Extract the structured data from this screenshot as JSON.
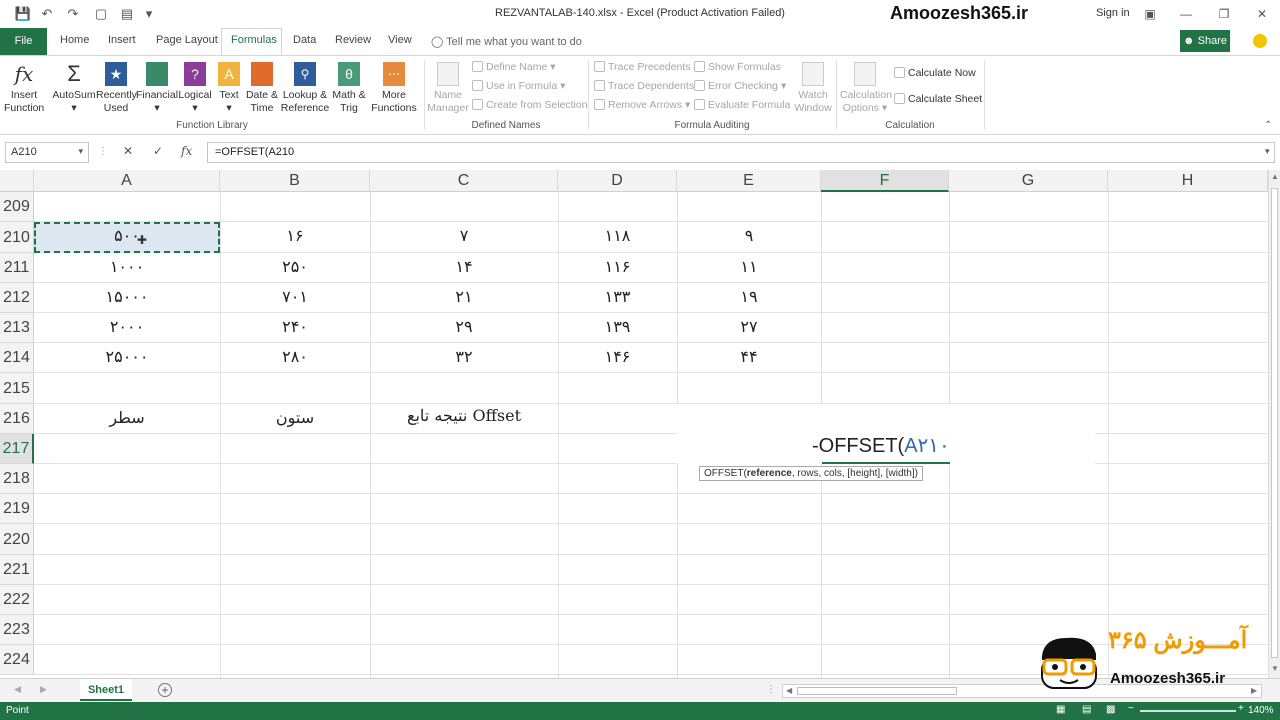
{
  "window": {
    "title": "REZVANTALAB-140.xlsx - Excel (Product Activation Failed)",
    "brand": "Amoozesh365.ir",
    "signin": "Sign in"
  },
  "tabs": [
    "File",
    "Home",
    "Insert",
    "Page Layout",
    "Formulas",
    "Data",
    "Review",
    "View"
  ],
  "active_tab": "Formulas",
  "tellme": "Tell me what you want to do",
  "share": "Share",
  "ribbon": {
    "insert_function": [
      "Insert",
      "Function"
    ],
    "autosum": "AutoSum",
    "recently_used": [
      "Recently",
      "Used"
    ],
    "financial": "Financial",
    "logical": "Logical",
    "text": "Text",
    "date_time": [
      "Date &",
      "Time"
    ],
    "lookup": [
      "Lookup &",
      "Reference"
    ],
    "math_trig": [
      "Math &",
      "Trig"
    ],
    "more_functions": [
      "More",
      "Functions"
    ],
    "function_library": "Function Library",
    "name_manager": [
      "Name",
      "Manager"
    ],
    "define_name": "Define Name",
    "use_in_formula": "Use in Formula",
    "create_from_selection": "Create from Selection",
    "defined_names": "Defined Names",
    "trace_precedents": "Trace Precedents",
    "trace_dependents": "Trace Dependents",
    "remove_arrows": "Remove Arrows",
    "show_formulas": "Show Formulas",
    "error_checking": "Error Checking",
    "evaluate_formula": "Evaluate Formula",
    "watch_window": [
      "Watch",
      "Window"
    ],
    "formula_auditing": "Formula Auditing",
    "calculation_options": [
      "Calculation",
      "Options"
    ],
    "calculate_now": "Calculate Now",
    "calculate_sheet": "Calculate Sheet",
    "calculation": "Calculation"
  },
  "formula_bar": {
    "name_box": "A210",
    "formula": "=OFFSET(A210"
  },
  "columns": [
    "A",
    "B",
    "C",
    "D",
    "E",
    "F",
    "G",
    "H"
  ],
  "rows": [
    "209",
    "210",
    "211",
    "212",
    "213",
    "214",
    "215",
    "216",
    "217",
    "218",
    "219",
    "220",
    "221",
    "222",
    "223",
    "224"
  ],
  "cells": {
    "r210": [
      "۵۰۰",
      "۱۶",
      "۷",
      "۱۱۸",
      "۹"
    ],
    "r211": [
      "۱۰۰۰",
      "۲۵۰",
      "۱۴",
      "۱۱۶",
      "۱۱"
    ],
    "r212": [
      "۱۵۰۰۰",
      "۷۰۱",
      "۲۱",
      "۱۳۳",
      "۱۹"
    ],
    "r213": [
      "۲۰۰۰",
      "۲۴۰",
      "۲۹",
      "۱۳۹",
      "۲۷"
    ],
    "r214": [
      "۲۵۰۰۰",
      "۲۸۰",
      "۳۲",
      "۱۴۶",
      "۴۴"
    ],
    "r216": [
      "سطر",
      "ستون",
      "نتیجه تابع Offset"
    ]
  },
  "edit": {
    "prefix": "-OFFSET(",
    "ref": "A۲۱۰",
    "tooltip_fn": "OFFSET(",
    "tooltip_bold": "reference",
    "tooltip_rest": ", rows, cols, [height], [width])"
  },
  "sheet_tab": "Sheet1",
  "status": {
    "mode": "Point",
    "zoom": "140%"
  },
  "logo": {
    "fa": "آمـــوزش ۳۶۵",
    "en": "Amoozesh365.ir"
  },
  "colors": {
    "accent": "#217346",
    "selection": "#dce7f1",
    "logo_orange": "#f29b00"
  }
}
